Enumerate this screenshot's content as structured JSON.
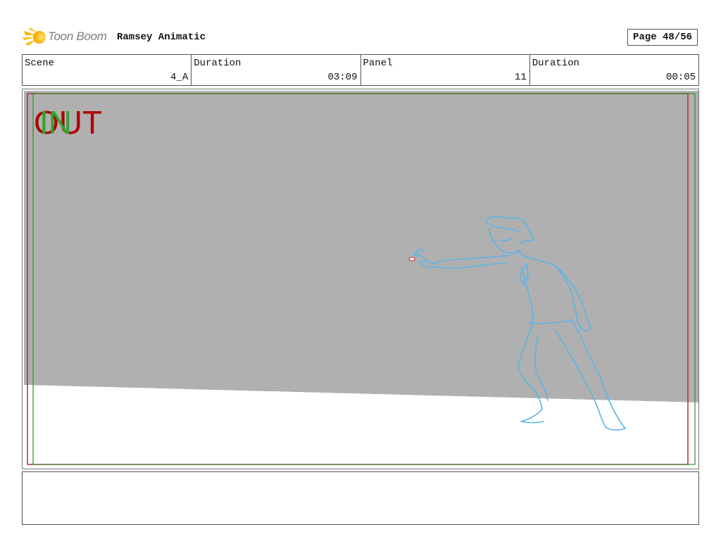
{
  "header": {
    "logo_text": "Toon Boom",
    "project_title": "Ramsey Animatic",
    "page_label": "Page 48/56"
  },
  "info": {
    "scene_label": "Scene",
    "scene_value": "4_A",
    "scene_duration_label": "Duration",
    "scene_duration_value": "03:09",
    "panel_label": "Panel",
    "panel_value": "11",
    "panel_duration_label": "Duration",
    "panel_duration_value": "00:05"
  },
  "panel": {
    "in_marker": "IN",
    "out_marker": "OUT",
    "colors": {
      "background_gray": "#b0b0b0",
      "frame_red": "#c0282d",
      "frame_green": "#2e8b2e",
      "sketch_blue": "#5ab4e8"
    }
  },
  "notes": {
    "text": ""
  },
  "icons": {
    "logo": "toon-boom-star-icon"
  }
}
